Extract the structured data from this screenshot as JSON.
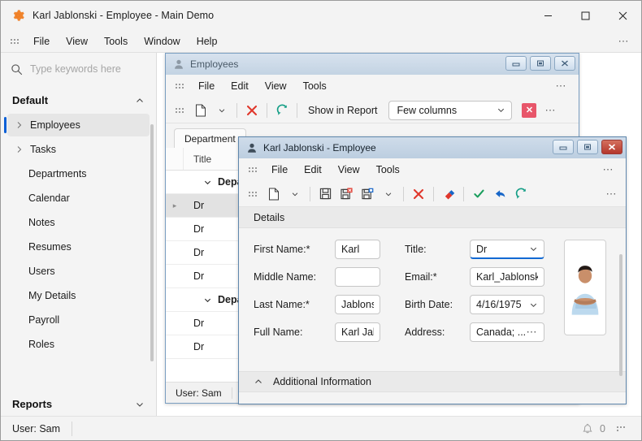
{
  "window": {
    "title": "Karl Jablonski - Employee - Main Demo",
    "icon": "gear-icon",
    "minimize": "—",
    "maximize": "□",
    "close": "✕"
  },
  "menubar": {
    "items": [
      "File",
      "View",
      "Tools",
      "Window",
      "Help"
    ],
    "overflow": "⋯"
  },
  "sidebar": {
    "search": {
      "placeholder": "Type keywords here",
      "value": "",
      "icon": "search-icon"
    },
    "groups": [
      {
        "label": "Default",
        "state": "expanded",
        "chevron": "chevron-up-icon"
      },
      {
        "label": "Reports",
        "state": "collapsed",
        "chevron": "chevron-down-icon"
      }
    ],
    "items": [
      {
        "label": "Employees",
        "selected": true,
        "expandable": true
      },
      {
        "label": "Tasks",
        "selected": false,
        "expandable": true
      },
      {
        "label": "Departments",
        "selected": false,
        "expandable": false
      },
      {
        "label": "Calendar",
        "selected": false,
        "expandable": false
      },
      {
        "label": "Notes",
        "selected": false,
        "expandable": false
      },
      {
        "label": "Resumes",
        "selected": false,
        "expandable": false
      },
      {
        "label": "Users",
        "selected": false,
        "expandable": false
      },
      {
        "label": "My Details",
        "selected": false,
        "expandable": false
      },
      {
        "label": "Payroll",
        "selected": false,
        "expandable": false
      },
      {
        "label": "Roles",
        "selected": false,
        "expandable": false
      }
    ]
  },
  "employees_window": {
    "title": "Employees",
    "icon": "person-icon",
    "menu": [
      "File",
      "Edit",
      "View",
      "Tools"
    ],
    "overflow": "⋯",
    "toolbar": {
      "new_icon": "new-document-icon",
      "new_dropdown_icon": "chevron-down-icon",
      "delete_icon": "delete-x-icon",
      "refresh_icon": "refresh-icon",
      "show_in_report_label": "Show in Report",
      "columns_combo_value": "Few columns",
      "columns_combo_chevron": "chevron-down-icon",
      "clear_filter_icon": "clear-filter-icon",
      "clear_filter_glyph": "✕",
      "overflow": "⋯"
    },
    "tabs": [
      {
        "label": "Department"
      }
    ],
    "grid": {
      "columns": [
        "Title"
      ],
      "rows": [
        {
          "type": "group",
          "label": "Depa",
          "chevron": "chevron-down-icon"
        },
        {
          "type": "data",
          "title": "Dr",
          "selected": true
        },
        {
          "type": "data",
          "title": "Dr",
          "selected": false
        },
        {
          "type": "data",
          "title": "Dr",
          "selected": false
        },
        {
          "type": "data",
          "title": "Dr",
          "selected": false
        },
        {
          "type": "group",
          "label": "Depa",
          "chevron": "chevron-down-icon"
        },
        {
          "type": "data",
          "title": "Dr",
          "selected": false
        },
        {
          "type": "data",
          "title": "Dr",
          "selected": false
        }
      ]
    },
    "status": "User: Sam",
    "buttons": {
      "minimize": "–",
      "maximize": "■",
      "close": "✕"
    }
  },
  "employee_dialog": {
    "title": "Karl Jablonski - Employee",
    "icon": "person-icon",
    "menu": [
      "File",
      "Edit",
      "View",
      "Tools"
    ],
    "overflow": "⋯",
    "toolbar": {
      "new_icon": "new-document-icon",
      "new_dropdown_icon": "chevron-down-icon",
      "save_icon": "save-icon",
      "save_close_icon": "save-and-close-icon",
      "save_new_icon": "save-and-new-icon",
      "save_dropdown_icon": "chevron-down-icon",
      "delete_icon": "delete-x-icon",
      "reset_icon": "eraser-icon",
      "validate_icon": "check-icon",
      "back_icon": "back-arrow-icon",
      "refresh_icon": "refresh-icon",
      "overflow": "⋯"
    },
    "sections": {
      "details": {
        "label": "Details"
      },
      "additional": {
        "label": "Additional Information",
        "chevron": "chevron-up-icon",
        "state": "expanded"
      }
    },
    "fields": [
      {
        "label": "First Name:*",
        "value": "Karl",
        "type": "text",
        "focused": false
      },
      {
        "label": "Middle Name:",
        "value": "",
        "type": "text",
        "focused": false
      },
      {
        "label": "Last Name:*",
        "value": "Jablons",
        "type": "text",
        "focused": false
      },
      {
        "label": "Full Name:",
        "value": "Karl Jab",
        "type": "text",
        "focused": false
      },
      {
        "label": "Title:",
        "value": "Dr",
        "type": "combo",
        "focused": true,
        "chevron": "chevron-down-icon"
      },
      {
        "label": "Email:*",
        "value": "Karl_Jablonski@",
        "type": "text",
        "focused": false
      },
      {
        "label": "Birth Date:",
        "value": "4/16/1975",
        "type": "combo",
        "focused": false,
        "chevron": "chevron-down-icon"
      },
      {
        "label": "Address:",
        "value": "Canada; ...",
        "type": "lookup",
        "focused": false,
        "button": "⋯"
      }
    ],
    "photo": {
      "name": "employee-photo",
      "alt": "Employee photo"
    },
    "buttons": {
      "minimize": "–",
      "maximize": "■",
      "close": "✕"
    }
  },
  "statusbar": {
    "user": "User: Sam",
    "notifications_icon": "bell-icon",
    "notifications_count": "0",
    "resize_grip": "resize-grip-icon"
  },
  "colors": {
    "accent": "#0a5fd6",
    "brand_gear": "#ef7d22",
    "danger": "#e0372c",
    "success": "#1a9e5d",
    "teal": "#159e86",
    "title_gradient_top": "#cfdcea",
    "title_gradient_bottom": "#bcced e"
  }
}
